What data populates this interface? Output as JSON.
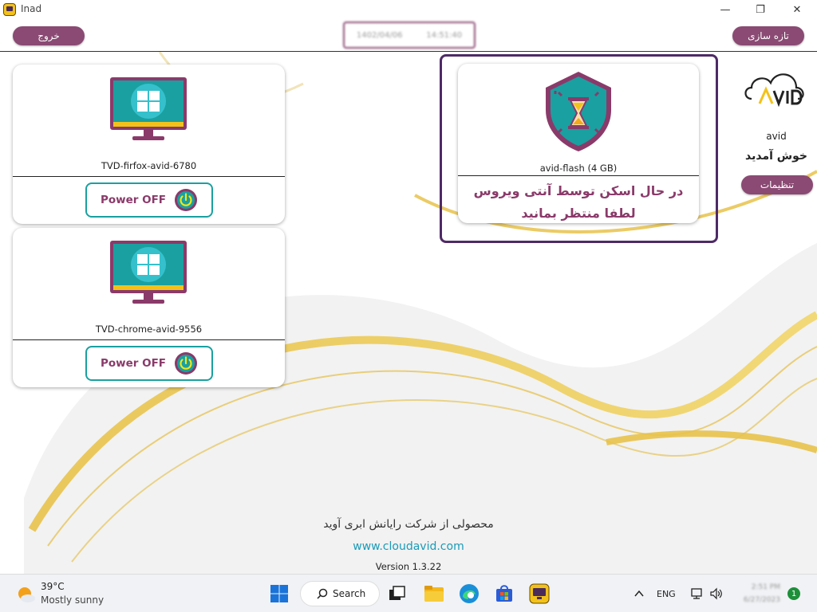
{
  "window": {
    "title": "Inad",
    "minimize": "—",
    "maximize": "❐",
    "close": "✕"
  },
  "header": {
    "logout_label": "خروج",
    "refresh_label": "تازه سازی",
    "date": "1402/04/06",
    "time": "14:51:40"
  },
  "vms": [
    {
      "name": "TVD-firfox-avid-6780",
      "power_label": "Power OFF"
    },
    {
      "name": "TVD-chrome-avid-9556",
      "power_label": "Power OFF"
    }
  ],
  "flash": {
    "name": "avid-flash  (4 GB)",
    "scan_line1": "در حال اسکن توسط آنتی ویروس",
    "scan_line2": "لطفا منتظر بمانید"
  },
  "user": {
    "username": "avid",
    "welcome": "خوش آمدید",
    "settings_label": "تنظیمات"
  },
  "footer": {
    "product": "محصولی از شرکت رایانش ابری آوید",
    "website": "www.cloudavid.com",
    "version": "Version 1.3.22"
  },
  "taskbar": {
    "temperature": "39°C",
    "condition": "Mostly sunny",
    "search_label": "Search",
    "language": "ENG",
    "clock_time": "2:51 PM",
    "clock_date": "6/27/2023",
    "notifications": "1"
  },
  "colors": {
    "accent_purple": "#8a4a73",
    "frame_purple": "#4e2a66",
    "teal": "#1aa0a0",
    "gold": "#f3c21a"
  }
}
